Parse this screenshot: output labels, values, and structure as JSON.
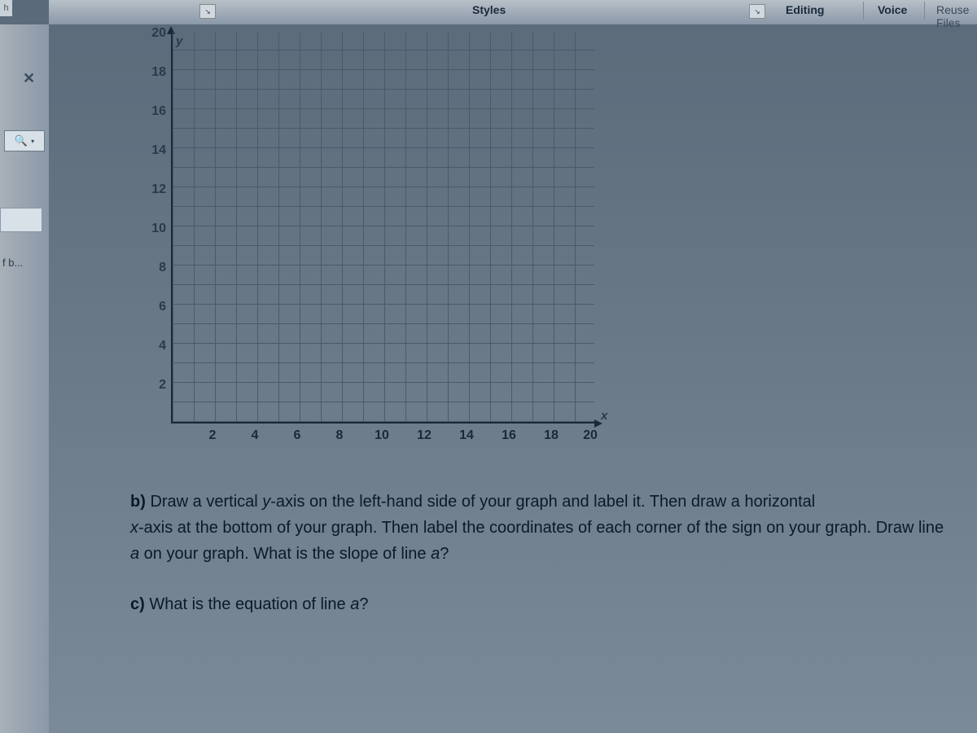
{
  "ribbon": {
    "left_fragment": "h",
    "styles": "Styles",
    "editing": "Editing",
    "voice": "Voice",
    "reuse": "Reuse Files",
    "expand_glyph": "↘"
  },
  "sidebar": {
    "close": "✕",
    "fb": "f b..."
  },
  "chart_data": {
    "type": "grid",
    "title": "",
    "xlabel": "x",
    "ylabel": "y",
    "xlim": [
      0,
      20
    ],
    "ylim": [
      0,
      20
    ],
    "x_ticks": [
      2,
      4,
      6,
      8,
      10,
      12,
      14,
      16,
      18,
      20
    ],
    "y_ticks": [
      2,
      4,
      6,
      8,
      10,
      12,
      14,
      16,
      18,
      20
    ],
    "series": []
  },
  "questions": {
    "b_label": "b)",
    "b_text_1": "Draw a vertical ",
    "b_italic_1": "y",
    "b_text_2": "-axis on the left-hand side of your graph and label it. Then draw a horizontal",
    "b_text_3": "",
    "b_italic_2": "x",
    "b_text_4": "-axis at the bottom of your graph. Then label the coordinates of each corner of the sign on your graph. Draw line ",
    "b_italic_3": "a",
    "b_text_5": " on your graph. What is the slope of line ",
    "b_italic_4": "a",
    "b_text_6": "?",
    "c_label": "c)",
    "c_text_1": "What is the equation of line ",
    "c_italic_1": "a",
    "c_text_2": "?"
  }
}
